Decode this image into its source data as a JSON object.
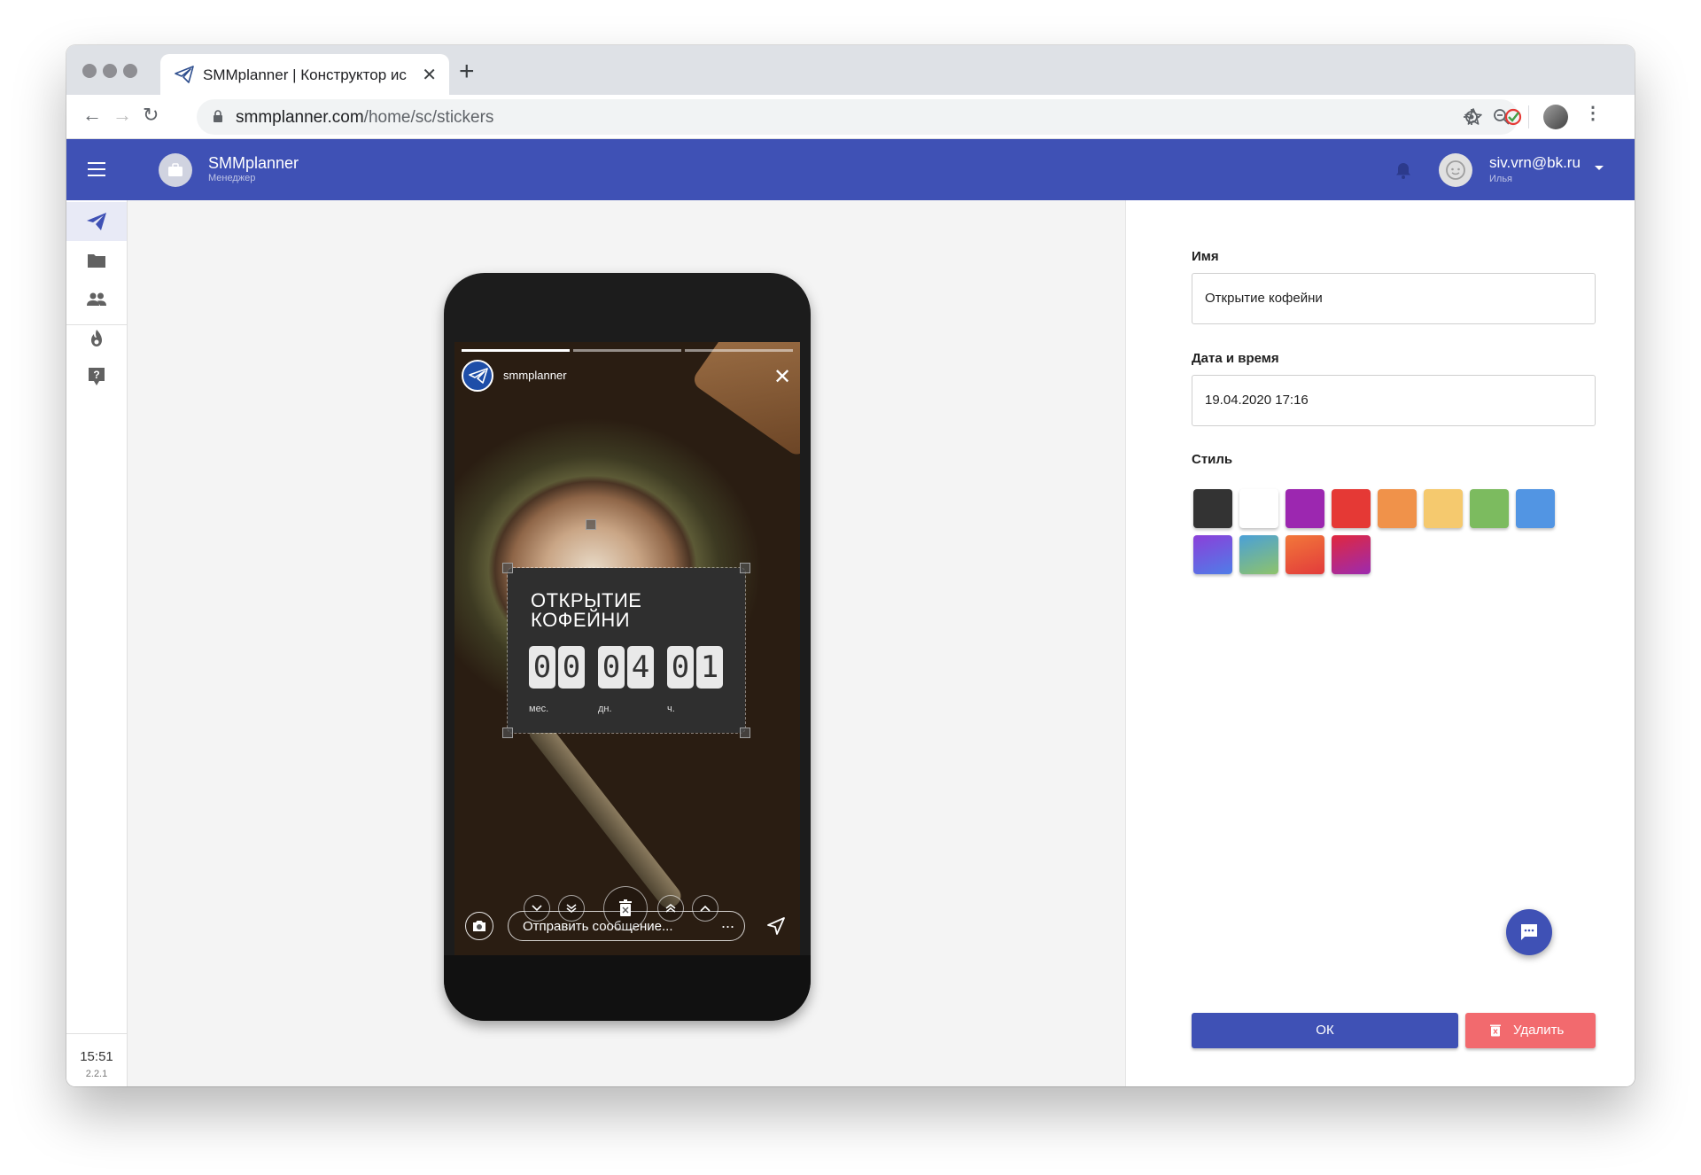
{
  "browser": {
    "tab_title": "SMMplanner | Конструктор ис",
    "url_host": "smmplanner.com",
    "url_path": "/home/sc/stickers"
  },
  "appbar": {
    "brand_title": "SMMplanner",
    "brand_subtitle": "Менеджер",
    "user_email": "siv.vrn@bk.ru",
    "user_name": "Илья"
  },
  "sidebar": {
    "items": [
      "send-icon",
      "folder-icon",
      "people-icon",
      "fire-icon",
      "help-icon"
    ],
    "time": "15:51",
    "version": "2.2.1"
  },
  "story": {
    "username": "smmplanner",
    "sticker_title": "ОТКРЫТИЕ КОФЕЙНИ",
    "digits": [
      "0",
      "0",
      "0",
      "4",
      "0",
      "1"
    ],
    "units": [
      "мес.",
      "дн.",
      "ч."
    ],
    "message_placeholder": "Отправить сообщение...",
    "more": "..."
  },
  "form": {
    "name_label": "Имя",
    "name_value": "Открытие кофейни",
    "datetime_label": "Дата и время",
    "datetime_value": "19.04.2020 17:16",
    "style_label": "Стиль",
    "swatches": [
      "#333333",
      "#ffffff",
      "#9c27b0",
      "#e53935",
      "#f0924a",
      "#f5c96e",
      "#7cbb5f",
      "#5295e3",
      "gradient-violet-blue",
      "gradient-blue-green",
      "gradient-orange-red",
      "gradient-red-purple"
    ],
    "ok_label": "ОК",
    "delete_label": "Удалить"
  },
  "colors": {
    "primary": "#3f51b5",
    "danger": "#f26a6e"
  }
}
